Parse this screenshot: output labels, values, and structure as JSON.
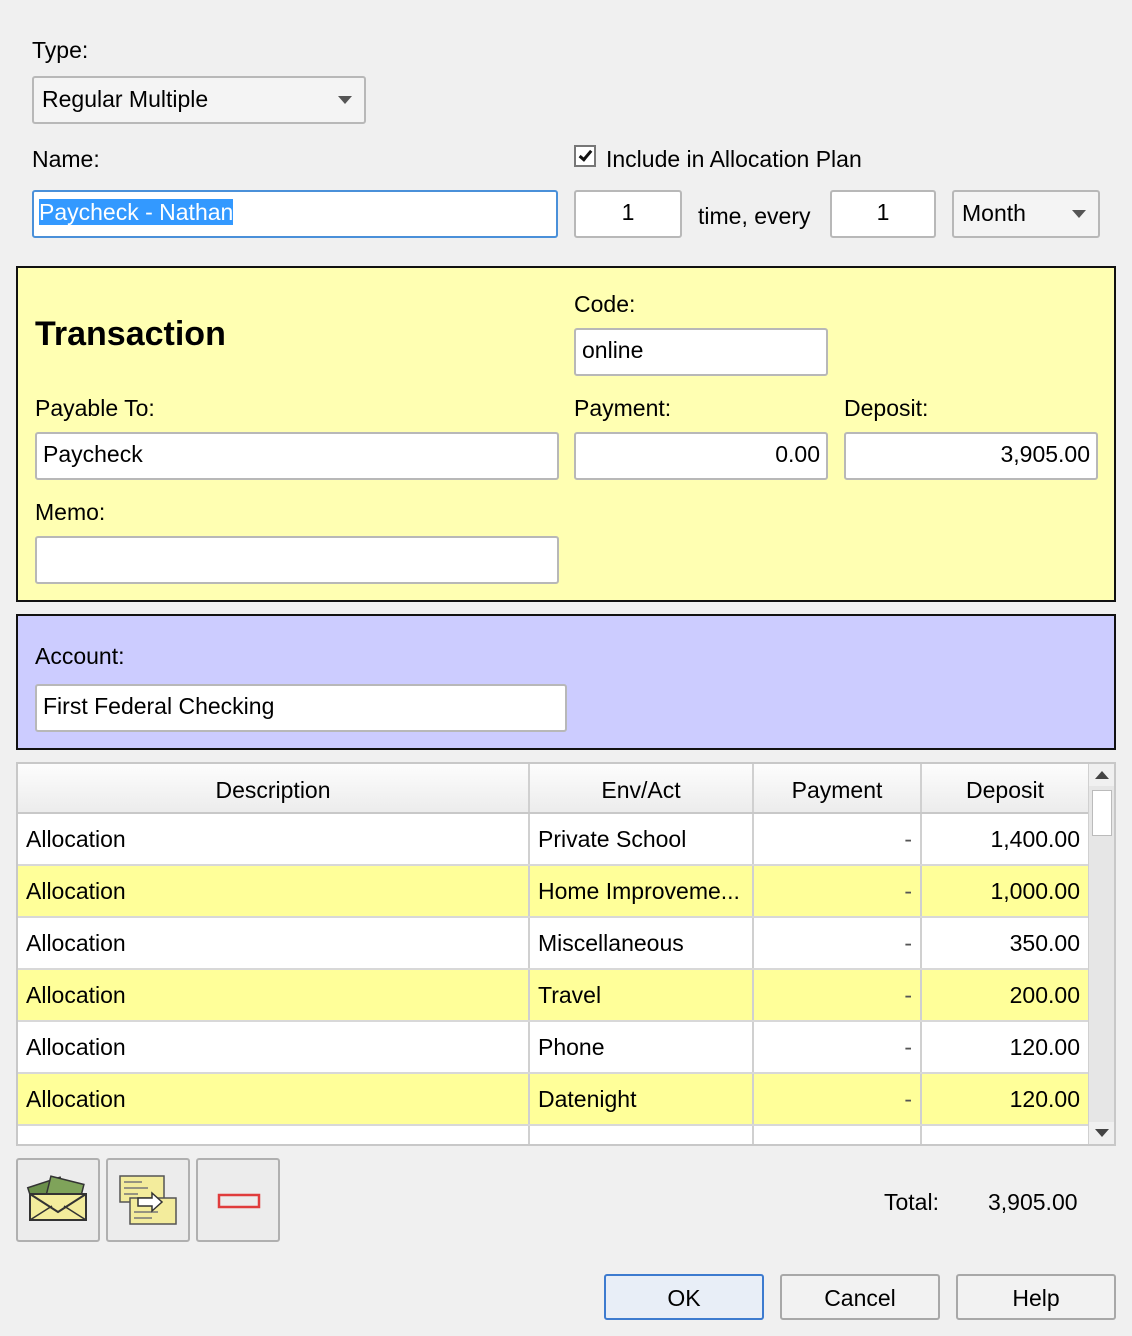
{
  "type_section": {
    "label": "Type:",
    "value": "Regular Multiple"
  },
  "name_section": {
    "label": "Name:",
    "value": "Paycheck - Nathan"
  },
  "allocation": {
    "checkbox_label": "Include in Allocation Plan",
    "checked": true,
    "times": "1",
    "time_every_label": "time, every",
    "interval": "1",
    "period": "Month"
  },
  "transaction": {
    "heading": "Transaction",
    "code_label": "Code:",
    "code_value": "online",
    "payable_label": "Payable To:",
    "payable_value": "Paycheck",
    "payment_label": "Payment:",
    "payment_value": "0.00",
    "deposit_label": "Deposit:",
    "deposit_value": "3,905.00",
    "memo_label": "Memo:",
    "memo_value": ""
  },
  "account": {
    "label": "Account:",
    "value": "First Federal Checking"
  },
  "table": {
    "headers": [
      "Description",
      "Env/Act",
      "Payment",
      "Deposit"
    ],
    "rows": [
      {
        "description": "Allocation",
        "env": "Private School",
        "payment": "-",
        "deposit": "1,400.00"
      },
      {
        "description": "Allocation",
        "env": "Home Improveme...",
        "payment": "-",
        "deposit": "1,000.00"
      },
      {
        "description": "Allocation",
        "env": "Miscellaneous",
        "payment": "-",
        "deposit": "350.00"
      },
      {
        "description": "Allocation",
        "env": "Travel",
        "payment": "-",
        "deposit": "200.00"
      },
      {
        "description": "Allocation",
        "env": "Phone",
        "payment": "-",
        "deposit": "120.00"
      },
      {
        "description": "Allocation",
        "env": "Datenight",
        "payment": "-",
        "deposit": "120.00"
      }
    ]
  },
  "icons": {
    "envelope": "money-envelope-icon",
    "transfer": "transfer-checks-icon",
    "remove": "remove-split-icon"
  },
  "colors": {
    "transaction_bg": "#ffffb2",
    "account_bg": "#ccccff",
    "row_highlight": "#ffff99"
  },
  "total": {
    "label": "Total:",
    "value": "3,905.00"
  },
  "buttons": {
    "ok": "OK",
    "cancel": "Cancel",
    "help": "Help"
  }
}
